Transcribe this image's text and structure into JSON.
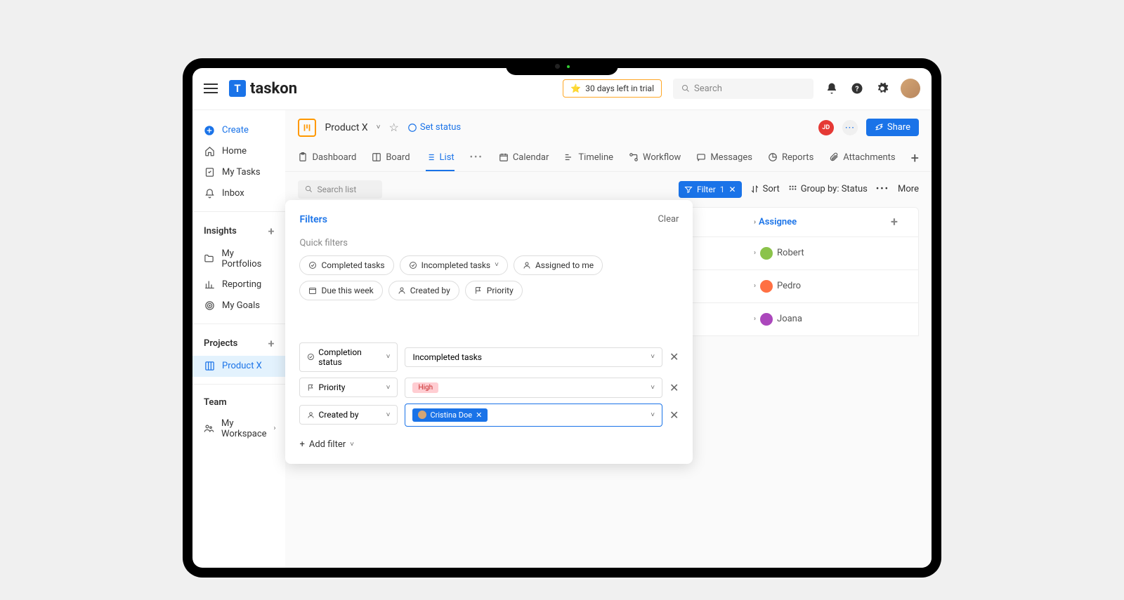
{
  "brand": "taskon",
  "trial": "30 days left in trial",
  "search_placeholder": "Search",
  "nav": {
    "create": "Create",
    "home": "Home",
    "mytasks": "My Tasks",
    "inbox": "Inbox"
  },
  "sections": {
    "insights": "Insights",
    "insights_items": {
      "portfolios": "My Portfolios",
      "reporting": "Reporting",
      "goals": "My Goals"
    },
    "projects": "Projects",
    "projects_items": {
      "productx": "Product X"
    },
    "team": "Team",
    "team_items": {
      "workspace": "My Workspace"
    }
  },
  "project": {
    "name": "Product X",
    "set_status": "Set status",
    "jd": "JD",
    "share": "Share"
  },
  "tabs": {
    "dashboard": "Dashboard",
    "board": "Board",
    "list": "List",
    "calendar": "Calendar",
    "timeline": "Timeline",
    "workflow": "Workflow",
    "messages": "Messages",
    "reports": "Reports",
    "attachments": "Attachments"
  },
  "toolbar": {
    "search_list": "Search list",
    "filter": "Filter",
    "filter_count": "1",
    "sort": "Sort",
    "groupby": "Group by: Status",
    "more": "More"
  },
  "table": {
    "assignee_col": "Assignee",
    "rows": {
      "0": "Robert",
      "1": "Pedro",
      "2": "Joana"
    }
  },
  "filters": {
    "title": "Filters",
    "clear": "Clear",
    "quick": "Quick filters",
    "chips": {
      "completed": "Completed tasks",
      "incompleted": "Incompleted tasks",
      "assigned": "Assigned to me",
      "due": "Due this week",
      "createdby": "Created by",
      "priority": "Priority"
    },
    "applied": {
      "f1_field": "Completion status",
      "f1_value": "Incompleted tasks",
      "f2_field": "Priority",
      "f2_value": "High",
      "f3_field": "Created by",
      "f3_value": "Cristina Doe"
    },
    "add": "Add filter"
  }
}
